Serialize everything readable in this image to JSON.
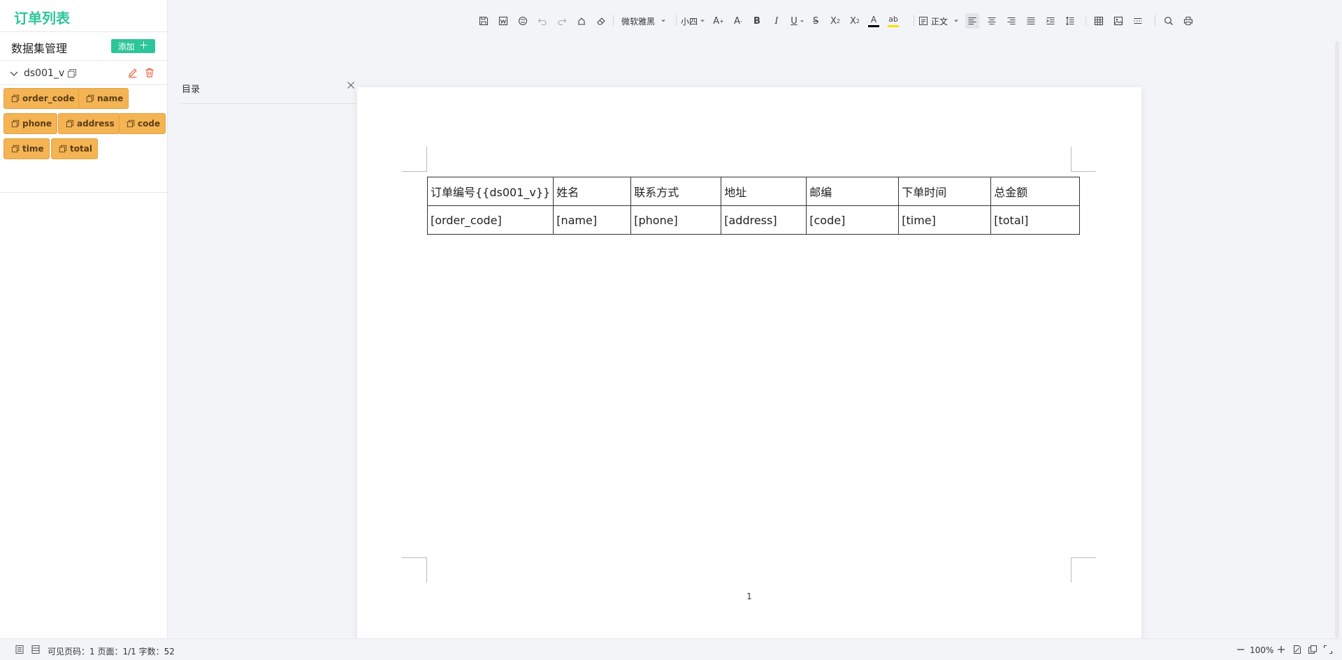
{
  "app": {
    "title": "订单列表"
  },
  "sidebar": {
    "dataset_title": "数据集管理",
    "add_label": "添加",
    "dataset": {
      "name": "ds001_v"
    },
    "fields": [
      "order_code",
      "name",
      "phone",
      "address",
      "code",
      "time",
      "total"
    ]
  },
  "toolbar": {
    "font_family": "微软雅黑",
    "font_size": "小四",
    "style": "正文",
    "icons": [
      "save-icon",
      "export-word-icon",
      "format-painter-icon",
      "undo-icon",
      "redo-icon",
      "paint-brush-icon",
      "eraser-icon",
      "font-grow-icon",
      "font-shrink-icon",
      "bold-icon",
      "italic-icon",
      "underline-icon",
      "strikethrough-icon",
      "superscript-icon",
      "subscript-icon",
      "font-color-icon",
      "highlight-icon",
      "align-left-icon",
      "align-center-icon",
      "align-right-icon",
      "justify-icon",
      "indent-icon",
      "line-spacing-icon",
      "table-icon",
      "image-icon",
      "separator-icon",
      "search-icon",
      "print-icon"
    ],
    "colors": {
      "font_color": "#000000",
      "highlight": "#f5e200"
    }
  },
  "toc": {
    "title": "目录"
  },
  "document": {
    "table": {
      "header": [
        "订单编号{{ds001_v}}",
        "姓名",
        "联系方式",
        "地址",
        "邮编",
        "下单时间",
        "总金额"
      ],
      "row": [
        "[order_code]",
        "[name]",
        "[phone]",
        "[address]",
        "[code]",
        "[time]",
        "[total]"
      ]
    },
    "page_number": "1"
  },
  "statusbar": {
    "text": "可见页码：1  页面：1/1  字数：52",
    "zoom": "100%"
  },
  "colors": {
    "brand": "#2dc59a",
    "chip": "#f4b454",
    "delete": "#e8613c"
  }
}
